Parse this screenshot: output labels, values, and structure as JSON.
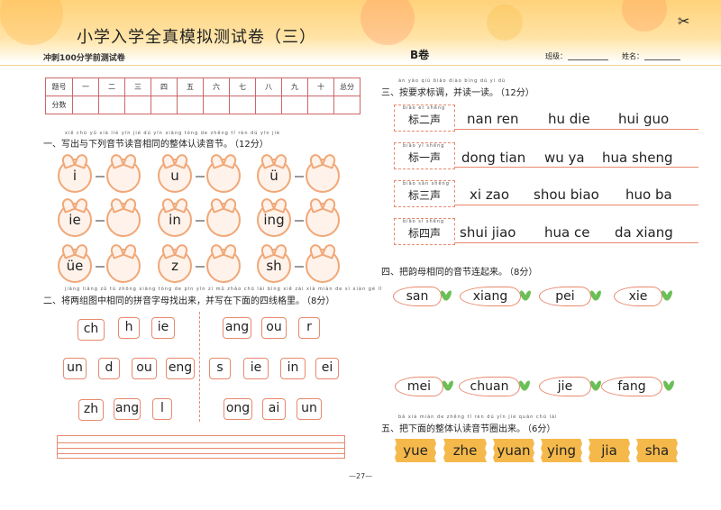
{
  "header": {
    "title": "小学入学全真模拟测试卷（三）",
    "subtitle": "冲刺100分学前测试卷",
    "volume": "B卷",
    "class_label": "班级：",
    "name_label": "姓名："
  },
  "score_table": {
    "header_row": [
      "题号",
      "一",
      "二",
      "三",
      "四",
      "五",
      "六",
      "七",
      "八",
      "九",
      "十",
      "总分"
    ],
    "score_label": "分数"
  },
  "section1": {
    "hint": "xiě chū yǔ xià liè yīn jié dú yīn xiāng tóng de zhěng tǐ rèn dú yīn jié",
    "title": "一、写出与下列音节读音相同的整体认读音节。",
    "score": "（12分）",
    "items": [
      "i",
      "u",
      "ü",
      "ie",
      "in",
      "ing",
      "üe",
      "z",
      "sh"
    ]
  },
  "section2": {
    "hint": "jiāng liǎng zǔ tú zhōng xiāng tóng de pīn yīn zì mǔ zhǎo chū lái bìng xiě zài xià miàn de sì xiàn gé lǐ",
    "title": "二、将两组图中相同的拼音字母找出来，并写在下面的四线格里。",
    "score": "（8分）",
    "left_group": [
      "ch",
      "h",
      "ie",
      "un",
      "d",
      "ou",
      "eng",
      "zh",
      "ang",
      "l"
    ],
    "right_group": [
      "ang",
      "ou",
      "r",
      "s",
      "ie",
      "in",
      "ei",
      "ong",
      "ai",
      "un"
    ]
  },
  "section3": {
    "hint": "àn yāo qiú biāo diào bìng dú yi dú",
    "title": "三、按要求标调，并读一读。",
    "score": "（12分）",
    "rows": [
      {
        "hint": "biāo èr shēng",
        "label": "标二声",
        "words": [
          "nan ren",
          "hu die",
          "hui guo"
        ]
      },
      {
        "hint": "biāo yī shēng",
        "label": "标一声",
        "words": [
          "dong tian",
          "wu ya",
          "hua sheng"
        ]
      },
      {
        "hint": "biāo sān shēng",
        "label": "标三声",
        "words": [
          "xi zao",
          "shou biao",
          "huo ba"
        ]
      },
      {
        "hint": "biāo sì shēng",
        "label": "标四声",
        "words": [
          "shui jiao",
          "hua ce",
          "da xiang"
        ]
      }
    ]
  },
  "section4": {
    "title": "四、把韵母相同的音节连起来。",
    "score": "（8分）",
    "top": [
      "san",
      "xiang",
      "pei",
      "xie"
    ],
    "bottom": [
      "mei",
      "chuan",
      "jie",
      "fang"
    ]
  },
  "section5": {
    "hint": "bǎ xià miàn de zhěng tǐ rèn dú yīn jié quān chū lái",
    "title": "五、把下面的整体认读音节圈出来。",
    "score": "（6分）",
    "items": [
      "yue",
      "zhe",
      "yuan",
      "ying",
      "jia",
      "sha"
    ]
  },
  "page_number": "—27—",
  "colors": {
    "accent": "#e8896e",
    "header_bg": "#ffd27a",
    "straw": "#f5b94b",
    "leaf": "#6abf56"
  }
}
